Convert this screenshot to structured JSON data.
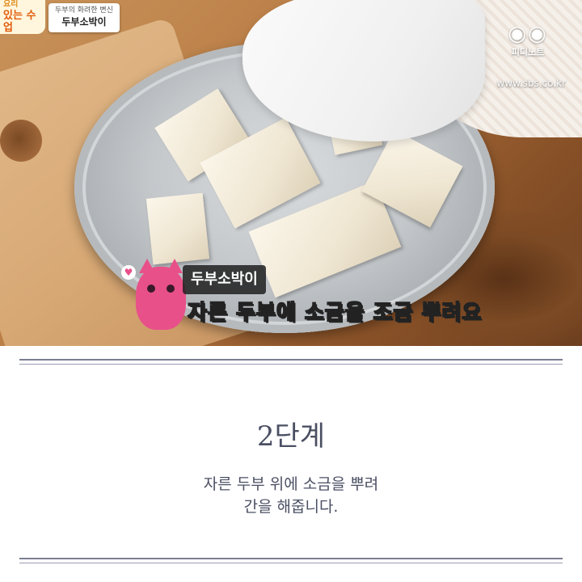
{
  "photo": {
    "show_logo_line1": "요리",
    "show_logo_line2": "있는 수업",
    "episode_subtitle": "두부의 화려한 변신",
    "episode_title": "두부소박이",
    "brand_name": "피디노트",
    "brand_url": "www.sbs.co.kr",
    "caption_tag": "두부소박이",
    "caption_text": "자른 두부에 소금을 조금 뿌려요"
  },
  "step": {
    "title": "2단계",
    "description_line1": "자른 두부 위에 소금을 뿌려",
    "description_line2": "간을 해줍니다."
  },
  "colors": {
    "text": "#4a4f63",
    "rule": "#7b7f93",
    "mascot": "#e8508a"
  }
}
